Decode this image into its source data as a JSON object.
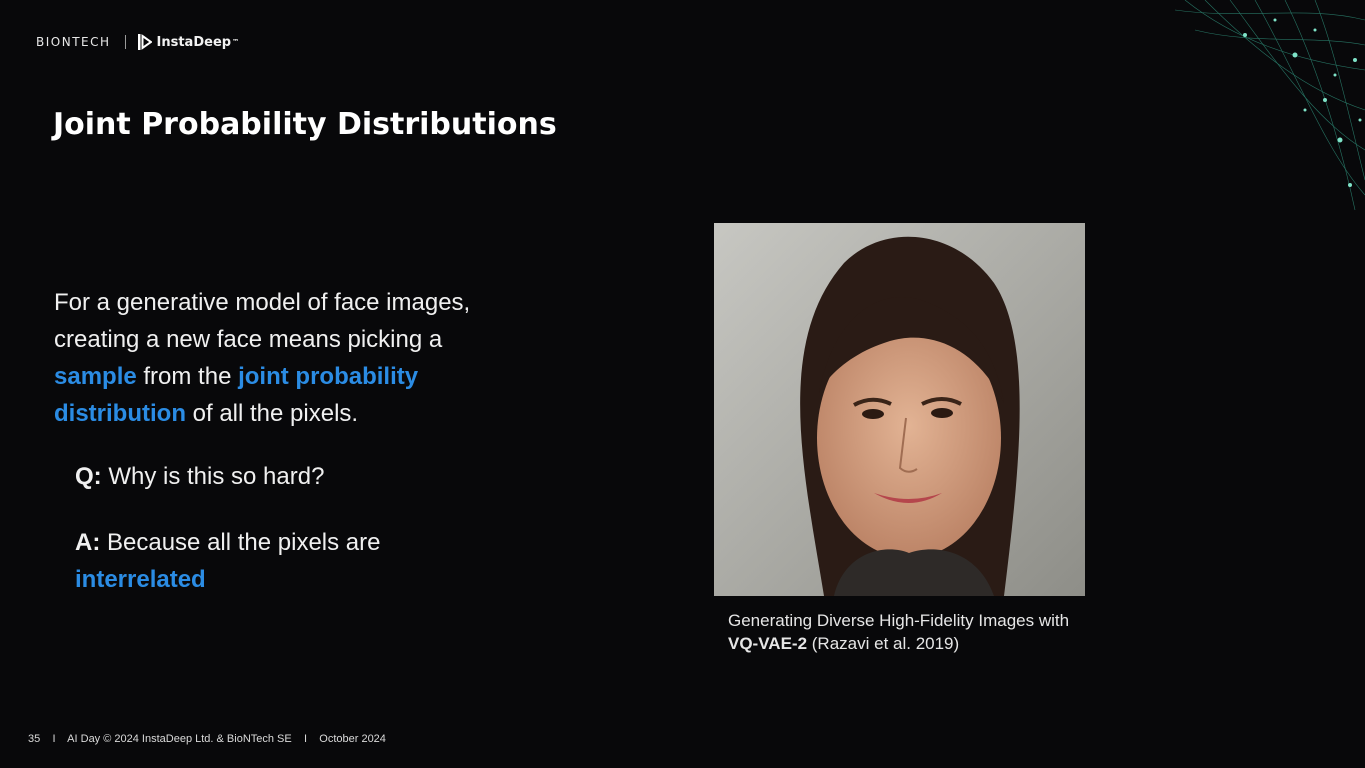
{
  "header": {
    "logo_biontech": "BIONTECH",
    "logo_instadeep": "InstaDeep",
    "logo_instadeep_tm": "™"
  },
  "title": "Joint Probability Distributions",
  "body": {
    "part1": "For a generative model of face images, creating a new face means picking a ",
    "sample": "sample",
    "part2": " from the ",
    "joint_probability": "joint probability distribution",
    "part3": " of all the pixels."
  },
  "qa": {
    "q_label": "Q:",
    "q_text": " Why is this so hard?",
    "a_label": "A:",
    "a_text": " Because all the pixels are ",
    "a_highlight": "interrelated"
  },
  "figure": {
    "caption_prefix": "Generating Diverse High-Fidelity Images with ",
    "model": "VQ-VAE-2",
    "citation": "  (Razavi et al. 2019)"
  },
  "footer": {
    "page_number": "35",
    "text": "AI Day © 2024 InstaDeep Ltd. & BioNTech SE",
    "date": "October 2024",
    "separator": "I"
  },
  "colors": {
    "background": "#08080a",
    "highlight": "#2b8ce4",
    "text": "#f0f0f0",
    "accent_teal": "#35c7a8"
  }
}
